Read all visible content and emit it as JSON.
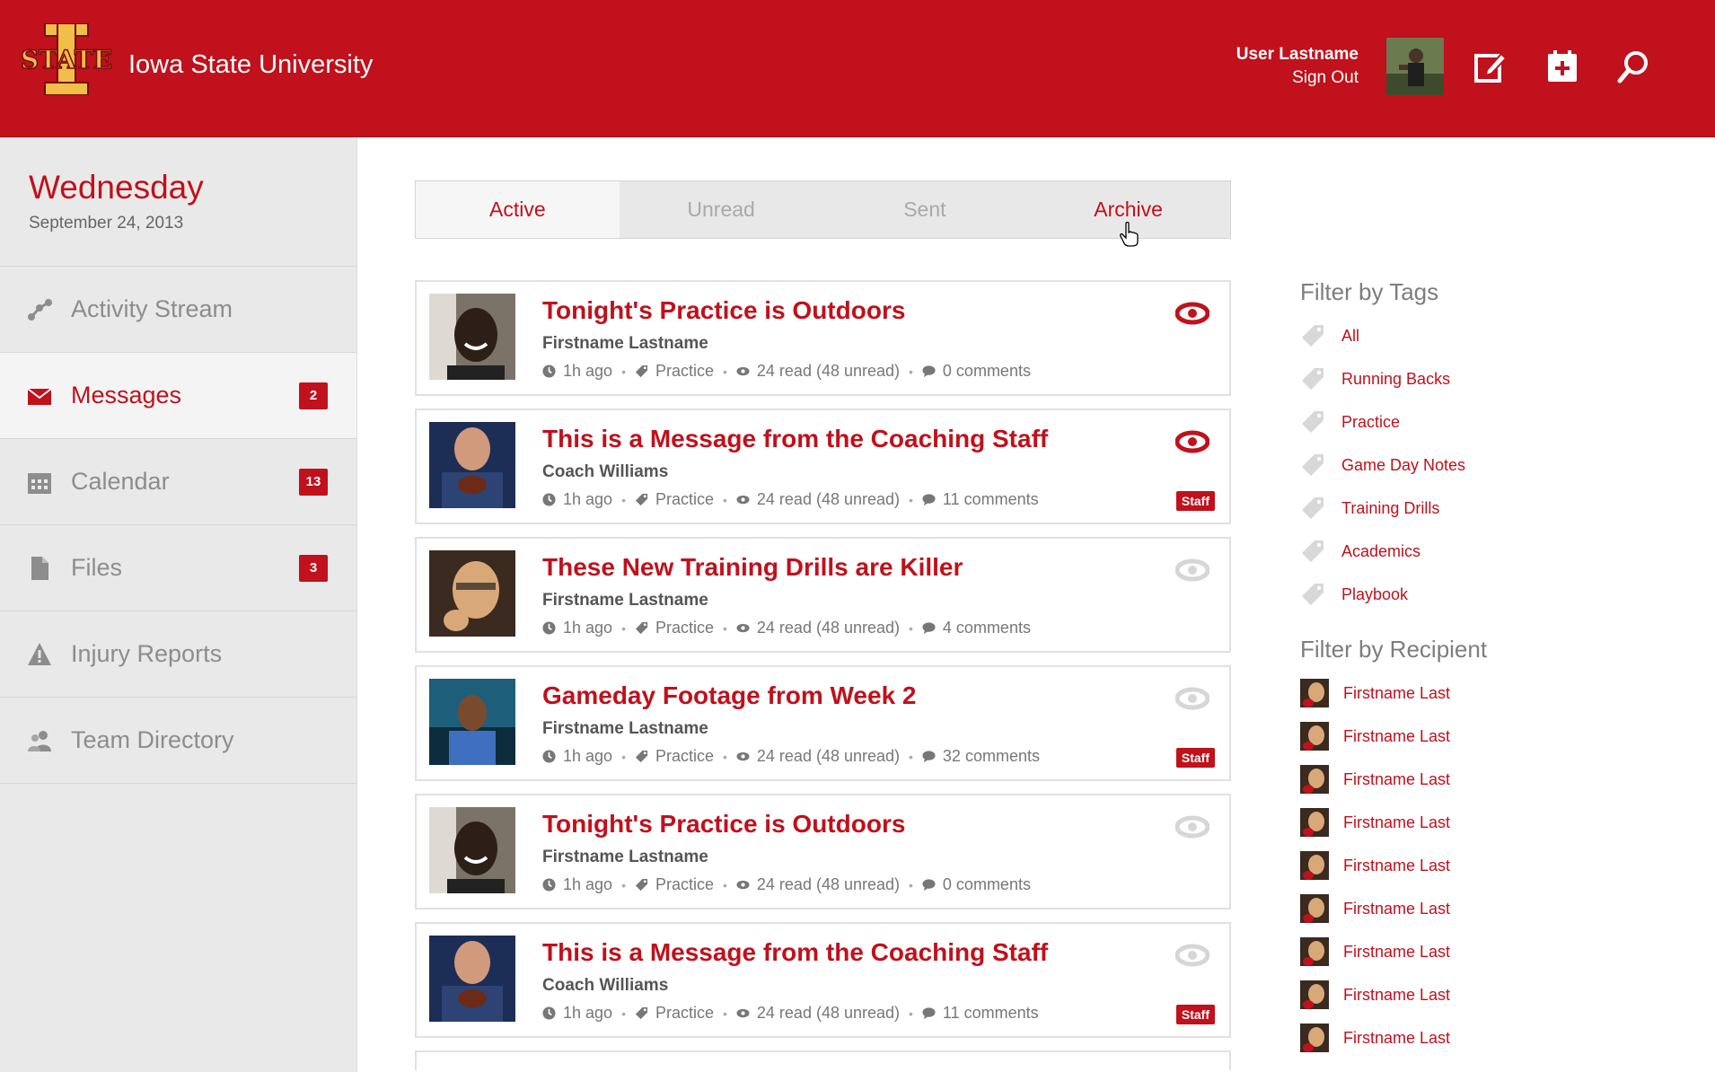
{
  "header": {
    "logo_text": "STATE",
    "university": "Iowa State University",
    "user_name": "User Lastname",
    "sign_out": "Sign Out",
    "icons": [
      "compose-icon",
      "calendar-add-icon",
      "search-icon"
    ],
    "brand_color": "#c0111c"
  },
  "sidebar": {
    "day": "Wednesday",
    "date": "September 24, 2013",
    "items": [
      {
        "label": "Activity Stream",
        "icon": "activity-icon",
        "badge": ""
      },
      {
        "label": "Messages",
        "icon": "envelope-icon",
        "badge": "2",
        "active": true
      },
      {
        "label": "Calendar",
        "icon": "calendar-icon",
        "badge": "13"
      },
      {
        "label": "Files",
        "icon": "file-icon",
        "badge": "3"
      },
      {
        "label": "Injury Reports",
        "icon": "warning-icon",
        "badge": ""
      },
      {
        "label": "Team Directory",
        "icon": "people-icon",
        "badge": ""
      }
    ]
  },
  "tabs": [
    {
      "label": "Active",
      "active": true
    },
    {
      "label": "Unread"
    },
    {
      "label": "Sent"
    },
    {
      "label": "Archive"
    }
  ],
  "messages": [
    {
      "title": "Tonight's Practice is Outdoors",
      "author": "Firstname Lastname",
      "time": "1h ago",
      "tag": "Practice",
      "reads": "24 read (48 unread)",
      "comments": "0 comments",
      "staff": "",
      "unread": true
    },
    {
      "title": "This is a Message from the Coaching Staff",
      "author": "Coach Williams",
      "time": "1h ago",
      "tag": "Practice",
      "reads": "24 read (48 unread)",
      "comments": "11 comments",
      "staff": "Staff",
      "unread": true
    },
    {
      "title": "These New Training Drills are Killer",
      "author": "Firstname Lastname",
      "time": "1h ago",
      "tag": "Practice",
      "reads": "24 read (48 unread)",
      "comments": "4 comments",
      "staff": "",
      "unread": false
    },
    {
      "title": "Gameday Footage from Week 2",
      "author": "Firstname Lastname",
      "time": "1h ago",
      "tag": "Practice",
      "reads": "24 read (48 unread)",
      "comments": "32 comments",
      "staff": "Staff",
      "unread": false
    },
    {
      "title": "Tonight's Practice is Outdoors",
      "author": "Firstname Lastname",
      "time": "1h ago",
      "tag": "Practice",
      "reads": "24 read (48 unread)",
      "comments": "0 comments",
      "staff": "",
      "unread": false
    },
    {
      "title": "This is a Message from the Coaching Staff",
      "author": "Coach Williams",
      "time": "1h ago",
      "tag": "Practice",
      "reads": "24 read (48 unread)",
      "comments": "11 comments",
      "staff": "Staff",
      "unread": false
    }
  ],
  "filters": {
    "tags_heading": "Filter by Tags",
    "tags": [
      "All",
      "Running Backs",
      "Practice",
      "Game Day Notes",
      "Training Drills",
      "Academics",
      "Playbook"
    ],
    "recipient_heading": "Filter by Recipient",
    "recipients": [
      "Firstname Last",
      "Firstname Last",
      "Firstname Last",
      "Firstname Last",
      "Firstname Last",
      "Firstname Last",
      "Firstname Last",
      "Firstname Last",
      "Firstname Last"
    ]
  }
}
